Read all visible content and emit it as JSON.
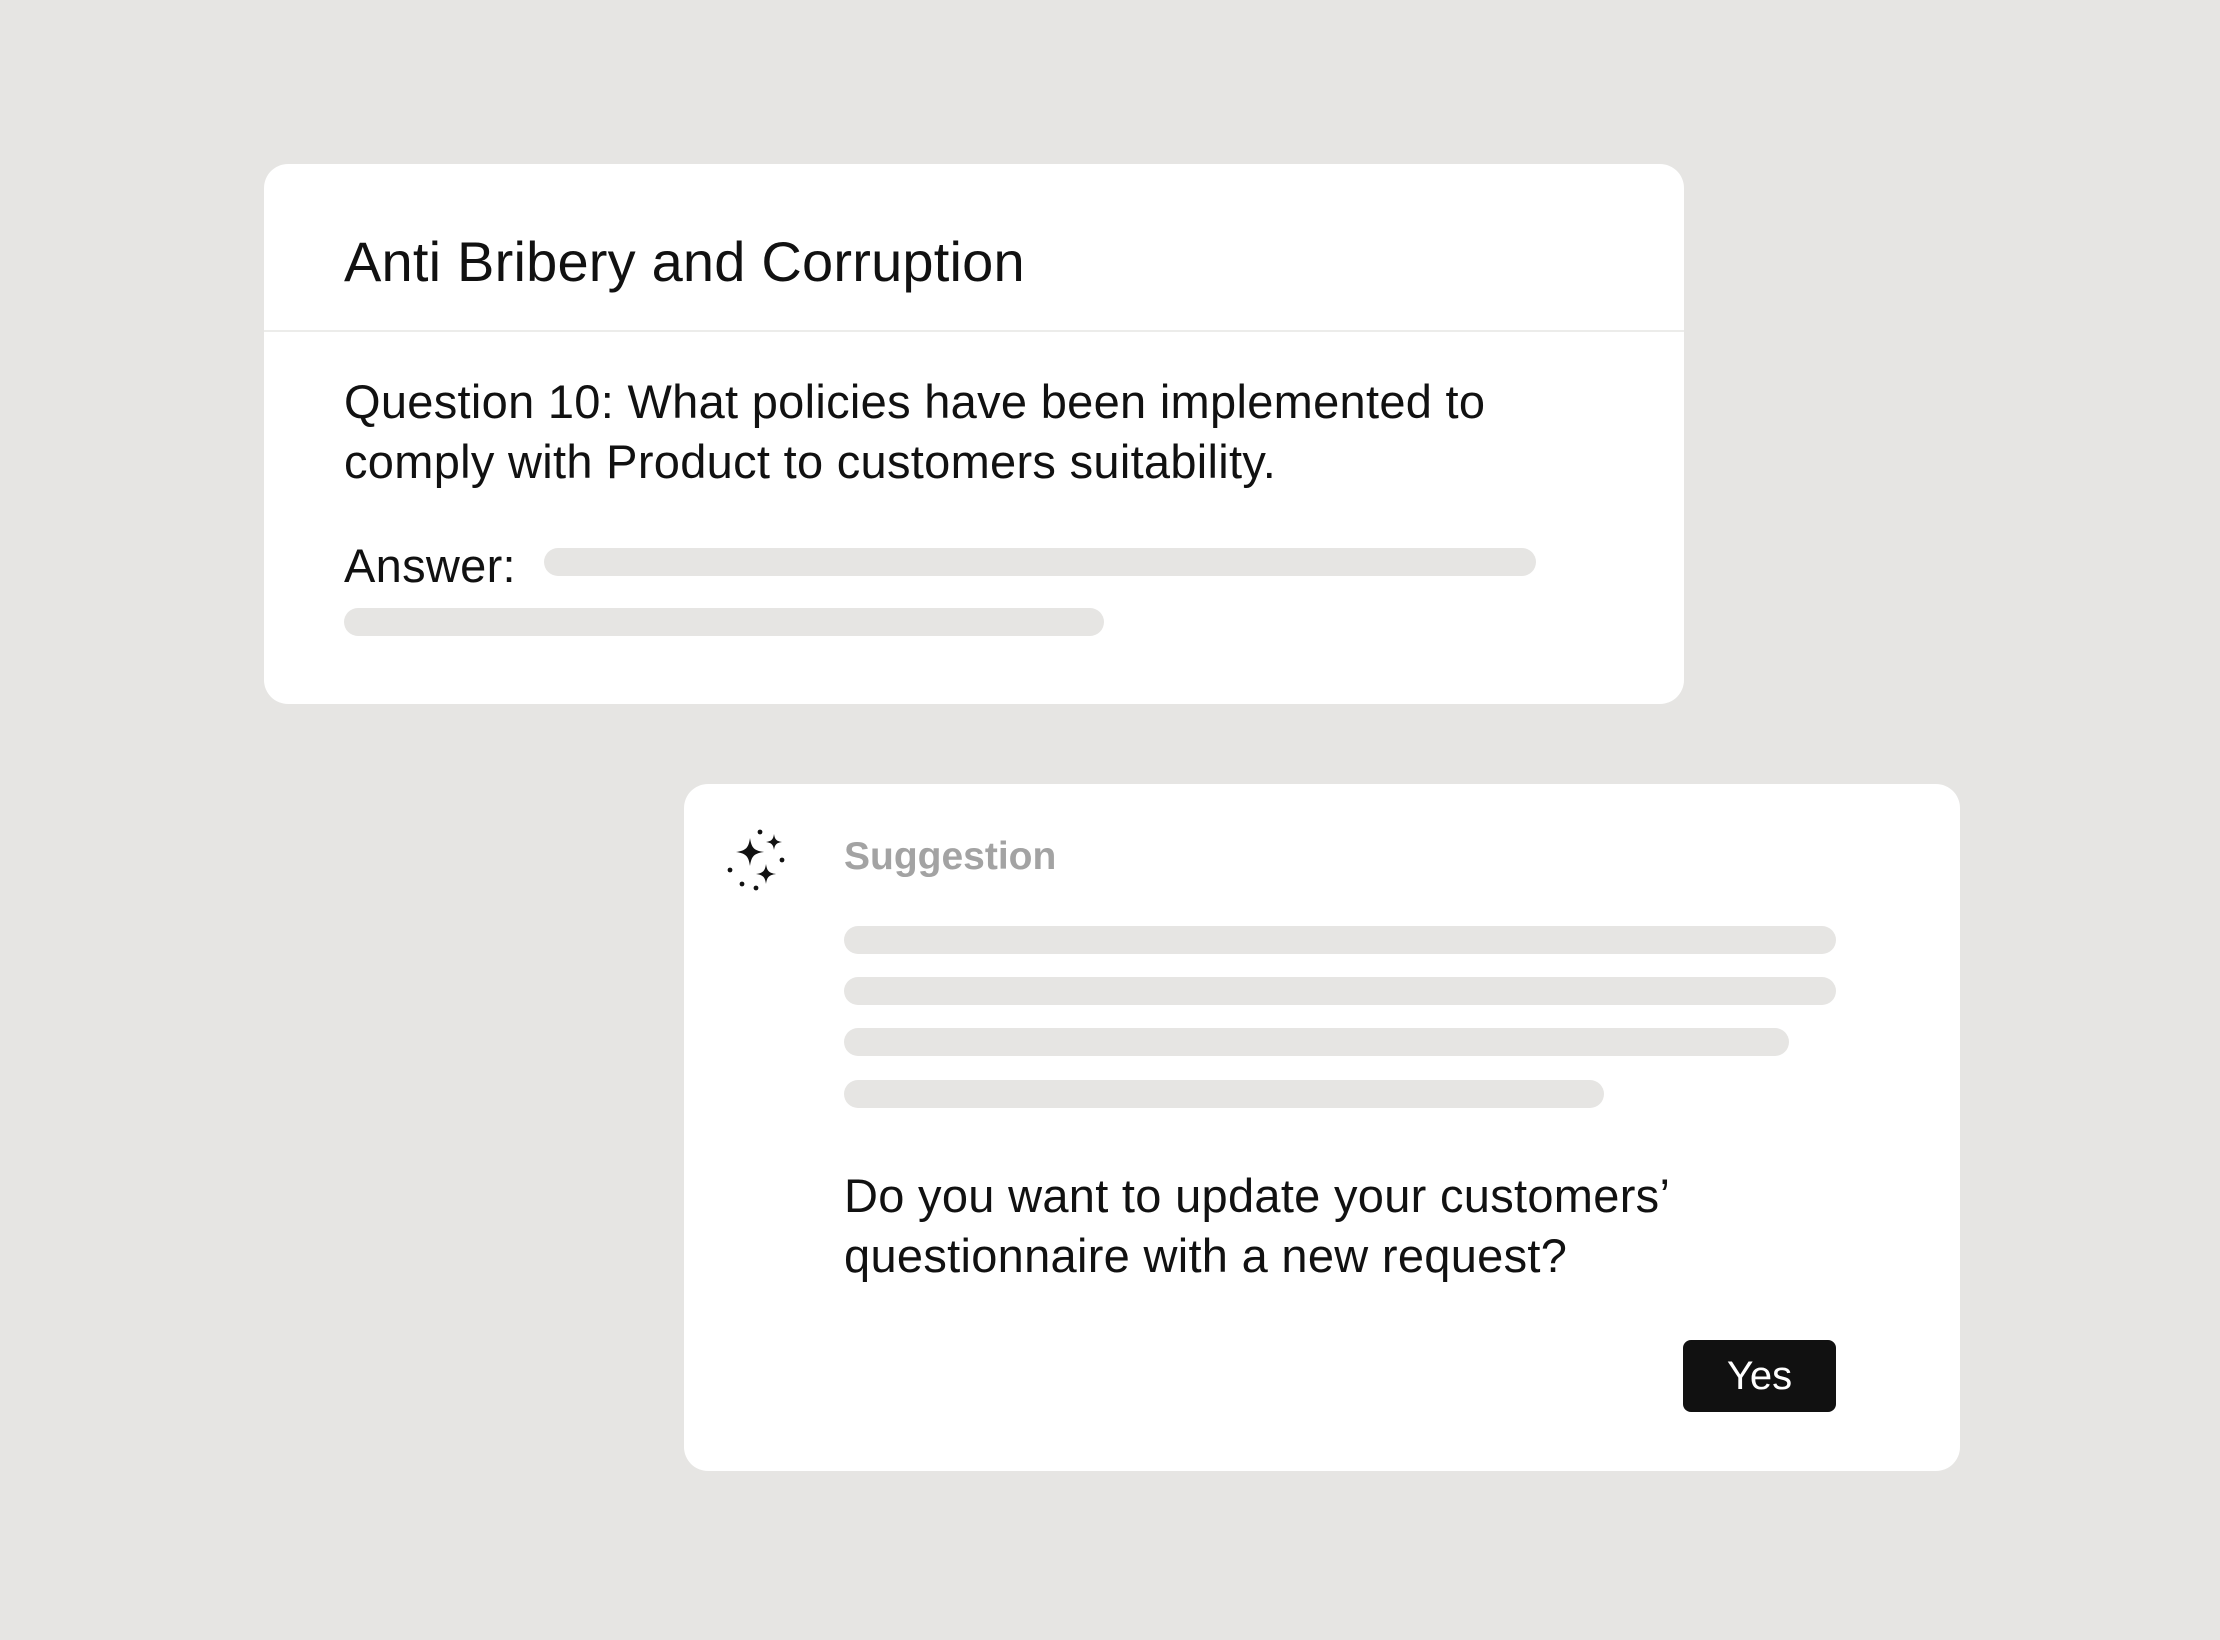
{
  "question_card": {
    "title": "Anti Bribery and Corruption",
    "question": "Question 10: What policies have been implemented to comply with Product to customers suitability.",
    "answer_label": "Answer:"
  },
  "suggestion_card": {
    "icon": "sparkles-icon",
    "label": "Suggestion",
    "prompt": "Do you want to update your customers’ questionnaire with a new request?",
    "confirm_label": "Yes"
  },
  "colors": {
    "background": "#e6e5e3",
    "card": "#ffffff",
    "skeleton": "#e6e5e3",
    "button": "#111111",
    "muted_label": "#a3a3a3"
  }
}
